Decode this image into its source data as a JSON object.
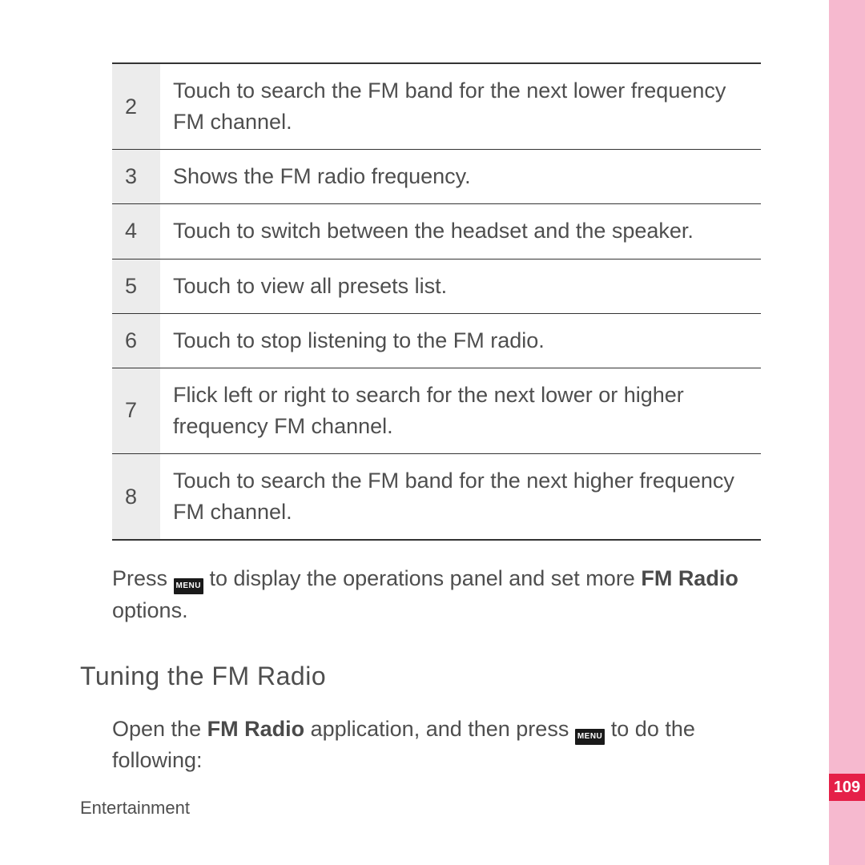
{
  "table": {
    "rows": [
      {
        "num": "2",
        "desc": "Touch to search the FM band for the next lower frequency FM channel."
      },
      {
        "num": "3",
        "desc": "Shows the FM radio frequency."
      },
      {
        "num": "4",
        "desc": "Touch to switch between the headset and the speaker."
      },
      {
        "num": "5",
        "desc": "Touch to view all presets list."
      },
      {
        "num": "6",
        "desc": "Touch to stop listening to the FM radio."
      },
      {
        "num": "7",
        "desc": "Flick left or right to search for the next lower or higher frequency FM channel."
      },
      {
        "num": "8",
        "desc": "Touch to search the FM band for the next higher frequency FM channel."
      }
    ]
  },
  "paragraph1": {
    "pre": "Press ",
    "menu_label": "MENU",
    "mid": " to display the operations panel and set more ",
    "bold": "FM Radio",
    "post": " options."
  },
  "section_heading": "Tuning the FM Radio",
  "paragraph2": {
    "pre": "Open the ",
    "bold": "FM Radio",
    "mid": " application, and then press ",
    "menu_label": "MENU",
    "post": " to do the following:"
  },
  "footer_chapter": "Entertainment",
  "page_number": "109"
}
